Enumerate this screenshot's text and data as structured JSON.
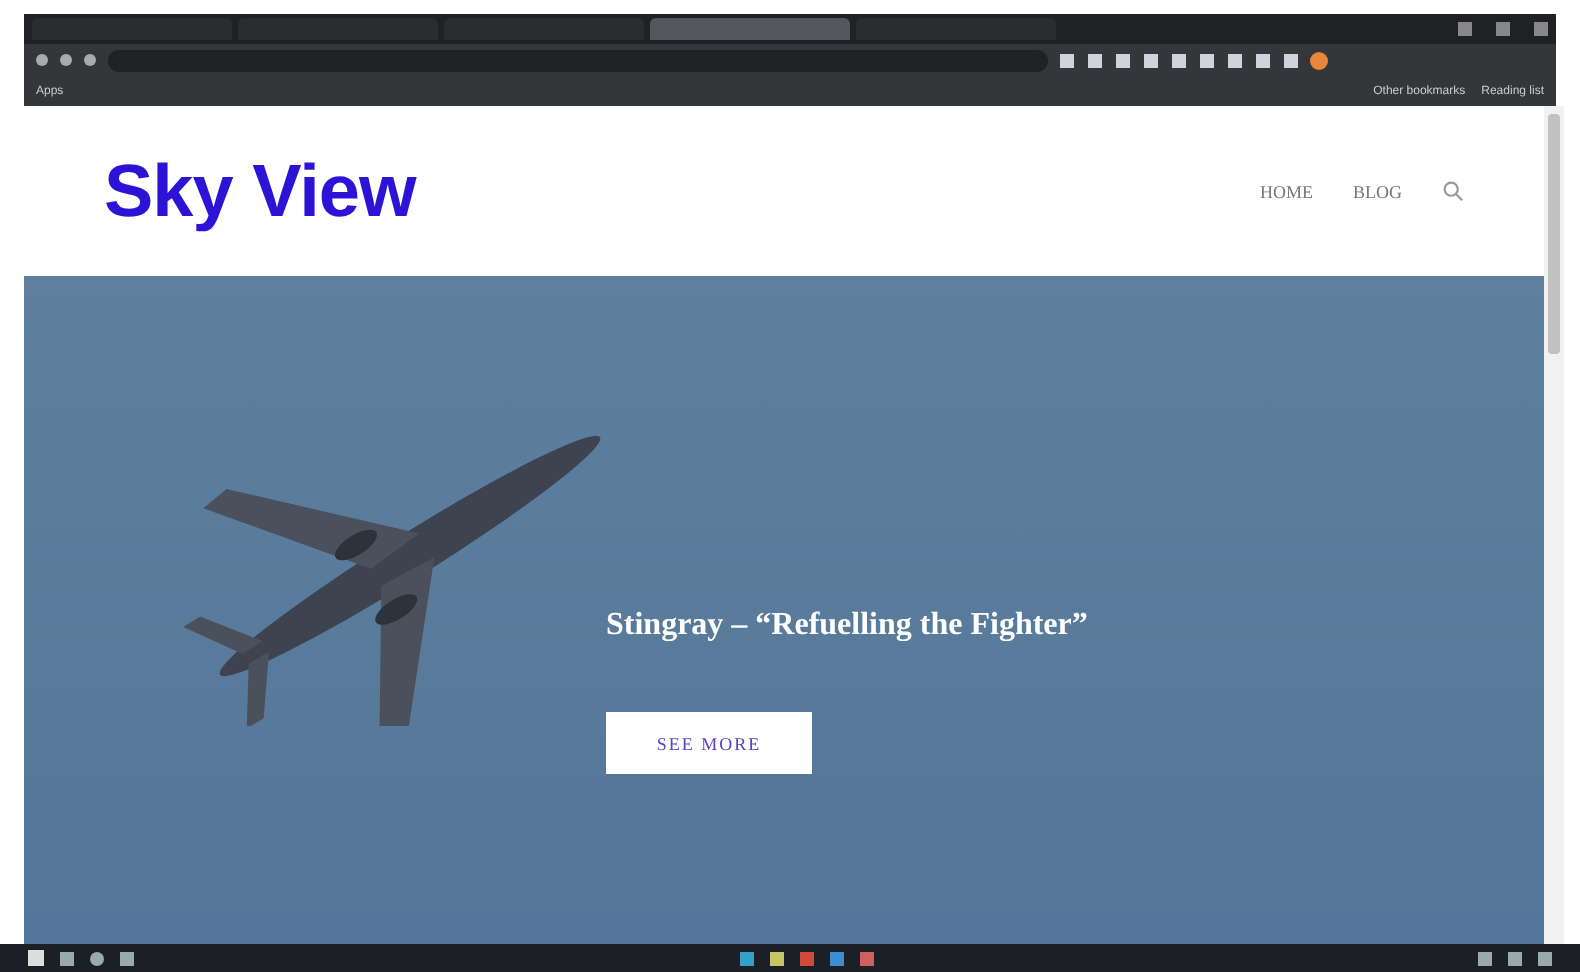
{
  "browser": {
    "tabs": [
      {
        "selected": false
      },
      {
        "selected": false
      },
      {
        "selected": false
      },
      {
        "selected": true
      },
      {
        "selected": false
      }
    ],
    "bookmarks": [
      {
        "label": "Apps"
      },
      {
        "label": "Other bookmarks"
      },
      {
        "label": "Reading list"
      }
    ]
  },
  "site": {
    "logo": "Sky View",
    "nav": [
      {
        "label": "HOME"
      },
      {
        "label": "BLOG"
      }
    ]
  },
  "hero": {
    "title": "Stingray – “Refuelling the Fighter”",
    "button": "SEE MORE"
  }
}
